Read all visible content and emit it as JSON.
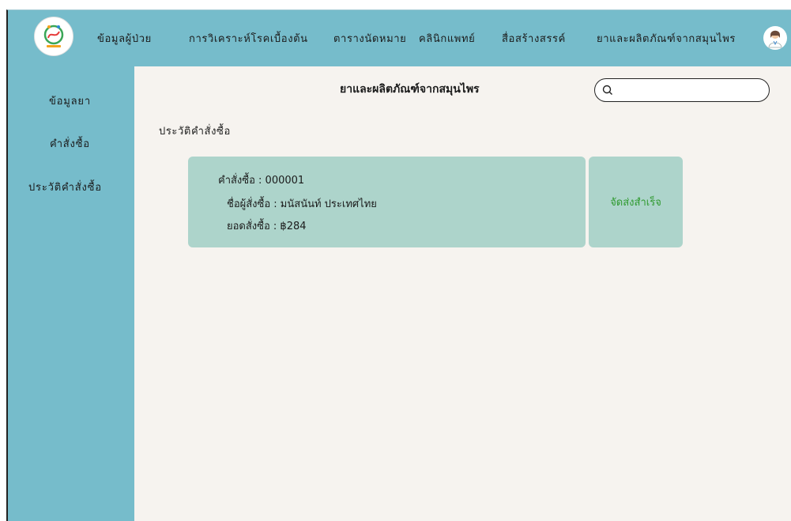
{
  "nav": {
    "items": [
      {
        "label": "ข้อมูลผู้ป่วย"
      },
      {
        "label": "การวิเคราะห์โรคเบื้องต้น"
      },
      {
        "label": "ตารางนัดหมาย"
      },
      {
        "label": "คลินิกแพทย์"
      },
      {
        "label": "สื่อสร้างสรรค์"
      },
      {
        "label": "ยาและผลิตภัณฑ์จากสมุนไพร"
      }
    ]
  },
  "sidebar": {
    "items": [
      {
        "label": "ข้อมูลยา"
      },
      {
        "label": "คำสั่งซื้อ"
      },
      {
        "label": "ประวัติคำสั่งซื้อ"
      }
    ]
  },
  "main": {
    "title": "ยาและผลิตภัณฑ์จากสมุนไพร",
    "search": {
      "value": "",
      "placeholder": ""
    },
    "section_title": "ประวัติคำสั่งซื้อ",
    "order": {
      "number_line": "คำสั่งซื้อ : 000001",
      "buyer_line": "ชื่อผู้สั่งซื้อ : มนัสนันท์ ประเทศไทย",
      "total_line": "ยอดสั่งซื้อ : ฿284",
      "status": "จัดส่งสำเร็จ"
    }
  },
  "colors": {
    "nav_bg": "#76bccb",
    "content_bg": "#f6f3ef",
    "card_bg": "#add4cb",
    "status_text": "#2f9a2f"
  },
  "icons": {
    "logo": "app-logo-icon",
    "avatar": "doctor-avatar-icon",
    "search": "search-icon"
  }
}
